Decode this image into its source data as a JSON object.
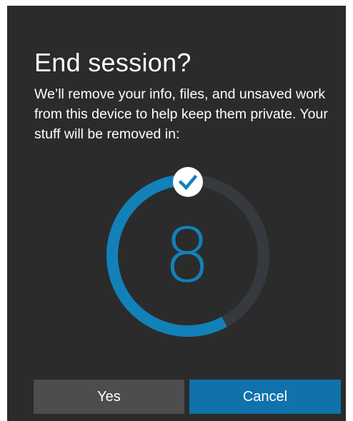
{
  "dialog": {
    "title": "End session?",
    "message": "We’ll remove your info, files, and unsaved work from this device to help keep them private. Your stuff will be removed in:",
    "countdown": {
      "seconds_remaining": "8",
      "progress_elapsed_fraction": 0.42,
      "ring_color": "#1281b8",
      "track_color": "#36393d",
      "badge_icon": "checkmark-icon"
    },
    "buttons": {
      "yes_label": "Yes",
      "cancel_label": "Cancel"
    },
    "colors": {
      "background": "#2b2b2b",
      "accent": "#0f72ab",
      "secondary_button": "#4d4d4d"
    }
  }
}
